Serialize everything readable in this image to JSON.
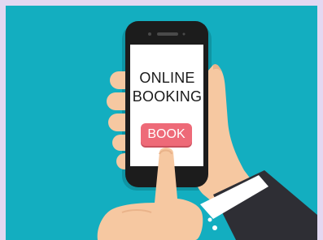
{
  "illustration": {
    "screen_lines": [
      "ONLINE",
      "BOOKING"
    ],
    "button_label": "BOOK",
    "colors": {
      "frame": "#e3d8f1",
      "background": "#13aec0",
      "phone": "#1c1c1c",
      "screen": "#ffffff",
      "button": "#ee6a78",
      "skin": "#f6c8a1",
      "sleeve": "#2e2e34",
      "cuff": "#ffffff"
    }
  }
}
